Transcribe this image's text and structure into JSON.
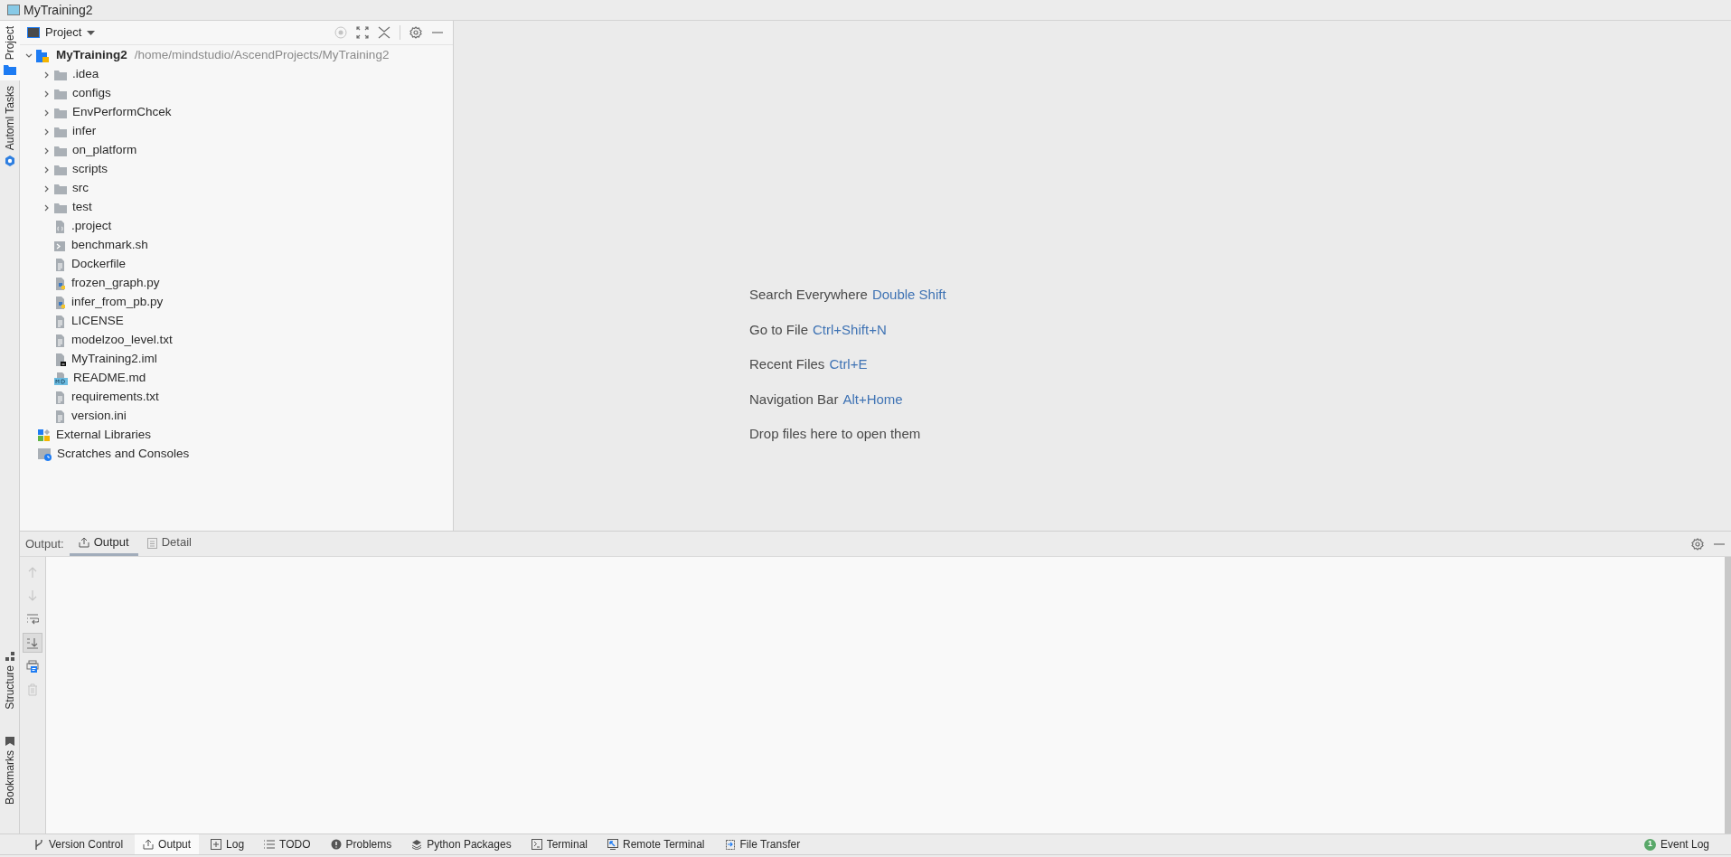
{
  "window": {
    "title": "MyTraining2"
  },
  "left_stripe": {
    "top": [
      {
        "kind": "project",
        "label": "Project",
        "selected": true
      },
      {
        "kind": "automl",
        "label": "Automl Tasks",
        "selected": false
      }
    ],
    "bottom": [
      {
        "kind": "structure",
        "label": "Structure",
        "selected": false
      },
      {
        "kind": "bookmarks",
        "label": "Bookmarks",
        "selected": false
      }
    ]
  },
  "project_panel": {
    "view_label": "Project",
    "root": {
      "name": "MyTraining2",
      "path": "/home/mindstudio/AscendProjects/MyTraining2",
      "expanded": true,
      "children": [
        {
          "kind": "folder",
          "name": ".idea",
          "expanded": false
        },
        {
          "kind": "folder",
          "name": "configs",
          "expanded": false
        },
        {
          "kind": "folder",
          "name": "EnvPerformChcek",
          "expanded": false
        },
        {
          "kind": "folder",
          "name": "infer",
          "expanded": false
        },
        {
          "kind": "folder",
          "name": "on_platform",
          "expanded": false
        },
        {
          "kind": "folder",
          "name": "scripts",
          "expanded": false
        },
        {
          "kind": "folder",
          "name": "src",
          "expanded": false
        },
        {
          "kind": "folder",
          "name": "test",
          "expanded": false
        },
        {
          "kind": "config",
          "name": ".project"
        },
        {
          "kind": "shell",
          "name": "benchmark.sh"
        },
        {
          "kind": "text",
          "name": "Dockerfile"
        },
        {
          "kind": "python",
          "name": "frozen_graph.py"
        },
        {
          "kind": "python",
          "name": "infer_from_pb.py"
        },
        {
          "kind": "text",
          "name": "LICENSE"
        },
        {
          "kind": "text",
          "name": "modelzoo_level.txt"
        },
        {
          "kind": "module",
          "name": "MyTraining2.iml"
        },
        {
          "kind": "markdown",
          "name": "README.md"
        },
        {
          "kind": "text",
          "name": "requirements.txt"
        },
        {
          "kind": "text",
          "name": "version.ini"
        }
      ]
    },
    "extra_nodes": [
      {
        "kind": "libraries",
        "name": "External Libraries"
      },
      {
        "kind": "scratches",
        "name": "Scratches and Consoles"
      }
    ]
  },
  "editor_hints": [
    {
      "text": "Search Everywhere",
      "shortcut": "Double Shift"
    },
    {
      "text": "Go to File",
      "shortcut": "Ctrl+Shift+N"
    },
    {
      "text": "Recent Files",
      "shortcut": "Ctrl+E"
    },
    {
      "text": "Navigation Bar",
      "shortcut": "Alt+Home"
    },
    {
      "text": "Drop files here to open them"
    }
  ],
  "output_panel": {
    "label": "Output:",
    "tabs": [
      {
        "kind": "output",
        "label": "Output",
        "selected": true
      },
      {
        "kind": "detail",
        "label": "Detail",
        "selected": false
      }
    ],
    "toolbar": [
      {
        "kind": "up",
        "disabled": true,
        "on": false
      },
      {
        "kind": "down",
        "disabled": true,
        "on": false
      },
      {
        "kind": "wrap",
        "disabled": false,
        "on": false
      },
      {
        "kind": "scroll",
        "disabled": false,
        "on": true
      },
      {
        "kind": "print",
        "disabled": false,
        "on": false
      },
      {
        "kind": "delete",
        "disabled": true,
        "on": false
      }
    ]
  },
  "bottom_bar": {
    "tools": [
      {
        "kind": "vcs",
        "label": "Version Control",
        "selected": false
      },
      {
        "kind": "output",
        "label": "Output",
        "selected": true
      },
      {
        "kind": "log",
        "label": "Log",
        "selected": false
      },
      {
        "kind": "todo",
        "label": "TODO",
        "selected": false
      },
      {
        "kind": "problems",
        "label": "Problems",
        "selected": false
      },
      {
        "kind": "packages",
        "label": "Python Packages",
        "selected": false
      },
      {
        "kind": "terminal",
        "label": "Terminal",
        "selected": false
      },
      {
        "kind": "remote",
        "label": "Remote Terminal",
        "selected": false
      },
      {
        "kind": "transfer",
        "label": "File Transfer",
        "selected": false
      }
    ],
    "event_log": {
      "count": "1",
      "label": "Event Log"
    }
  }
}
